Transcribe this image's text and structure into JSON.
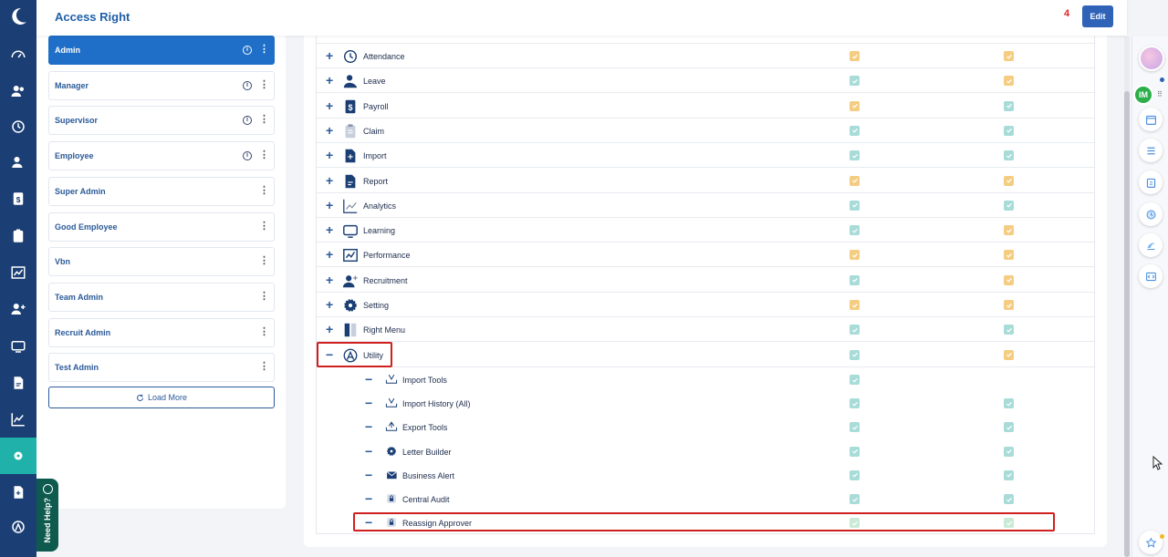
{
  "header": {
    "title": "Access Right",
    "notification_count": "4",
    "edit_label": "Edit"
  },
  "nav": {
    "icons": [
      "moon-logo-icon",
      "dashboard-icon",
      "people-icon",
      "clock-icon",
      "leave-icon",
      "payroll-icon",
      "claim-icon",
      "chart-icon",
      "add-user-icon",
      "learning-icon",
      "report-icon",
      "analytics-icon",
      "setting-icon",
      "import-icon",
      "utility-icon"
    ]
  },
  "roles": {
    "items": [
      {
        "label": "Admin",
        "has_info": true,
        "active": true
      },
      {
        "label": "Manager",
        "has_info": true,
        "active": false
      },
      {
        "label": "Supervisor",
        "has_info": true,
        "active": false
      },
      {
        "label": "Employee",
        "has_info": true,
        "active": false
      },
      {
        "label": "Super Admin",
        "has_info": false,
        "active": false
      },
      {
        "label": "Good Employee",
        "has_info": false,
        "active": false
      },
      {
        "label": "Vbn",
        "has_info": false,
        "active": false
      },
      {
        "label": "Team Admin",
        "has_info": false,
        "active": false
      },
      {
        "label": "Recruit Admin",
        "has_info": false,
        "active": false
      },
      {
        "label": "Test Admin",
        "has_info": false,
        "active": false
      }
    ],
    "load_more_label": "Load More"
  },
  "modules": {
    "rows": [
      {
        "label": "Attendance",
        "icon": "attendance-icon",
        "expanded": false,
        "c1": "orange",
        "c2": "orange"
      },
      {
        "label": "Leave",
        "icon": "leave-icon",
        "expanded": false,
        "c1": "teal",
        "c2": "orange"
      },
      {
        "label": "Payroll",
        "icon": "payroll-icon",
        "expanded": false,
        "c1": "orange",
        "c2": "teal"
      },
      {
        "label": "Claim",
        "icon": "claim-icon",
        "expanded": false,
        "c1": "teal",
        "c2": "teal"
      },
      {
        "label": "Import",
        "icon": "import-icon",
        "expanded": false,
        "c1": "teal",
        "c2": "teal"
      },
      {
        "label": "Report",
        "icon": "report-icon",
        "expanded": false,
        "c1": "orange",
        "c2": "orange"
      },
      {
        "label": "Analytics",
        "icon": "analytics-icon",
        "expanded": false,
        "c1": "teal",
        "c2": "teal"
      },
      {
        "label": "Learning",
        "icon": "learning-icon",
        "expanded": false,
        "c1": "teal",
        "c2": "orange"
      },
      {
        "label": "Performance",
        "icon": "performance-icon",
        "expanded": false,
        "c1": "orange",
        "c2": "orange"
      },
      {
        "label": "Recruitment",
        "icon": "recruitment-icon",
        "expanded": false,
        "c1": "teal",
        "c2": "orange"
      },
      {
        "label": "Setting",
        "icon": "setting-icon",
        "expanded": false,
        "c1": "orange",
        "c2": "orange"
      },
      {
        "label": "Right Menu",
        "icon": "right-menu-icon",
        "expanded": false,
        "c1": "teal",
        "c2": "teal"
      },
      {
        "label": "Utility",
        "icon": "utility-icon",
        "expanded": true,
        "c1": "teal",
        "c2": "orange"
      }
    ],
    "utility_children": [
      {
        "label": "Import Tools",
        "icon": "import-tools-icon",
        "c1": "teal",
        "c2": null
      },
      {
        "label": "Import History (All)",
        "icon": "import-history-icon",
        "c1": "teal",
        "c2": "teal"
      },
      {
        "label": "Export Tools",
        "icon": "export-tools-icon",
        "c1": "teal",
        "c2": "teal"
      },
      {
        "label": "Letter Builder",
        "icon": "letter-builder-icon",
        "c1": "teal",
        "c2": "teal"
      },
      {
        "label": "Business Alert",
        "icon": "business-alert-icon",
        "c1": "teal",
        "c2": "teal"
      },
      {
        "label": "Central Audit",
        "icon": "lock-icon",
        "c1": "teal",
        "c2": "teal"
      },
      {
        "label": "Reassign Approver",
        "icon": "lock-icon",
        "c1": "gray",
        "c2": "gray"
      }
    ]
  },
  "colors": {
    "nav_bg": "#1b3f74",
    "accent": "#1f6fc8",
    "check_orange": "#f5cd82",
    "check_teal": "#a8dcd8",
    "highlight": "#d01f1f"
  },
  "right_rail": {
    "im_label": "IM",
    "buttons": [
      "calendar-icon",
      "list-icon",
      "clipboard-icon",
      "clock-icon",
      "feedback-icon",
      "code-icon"
    ]
  },
  "help": {
    "label": "Need Help?"
  }
}
